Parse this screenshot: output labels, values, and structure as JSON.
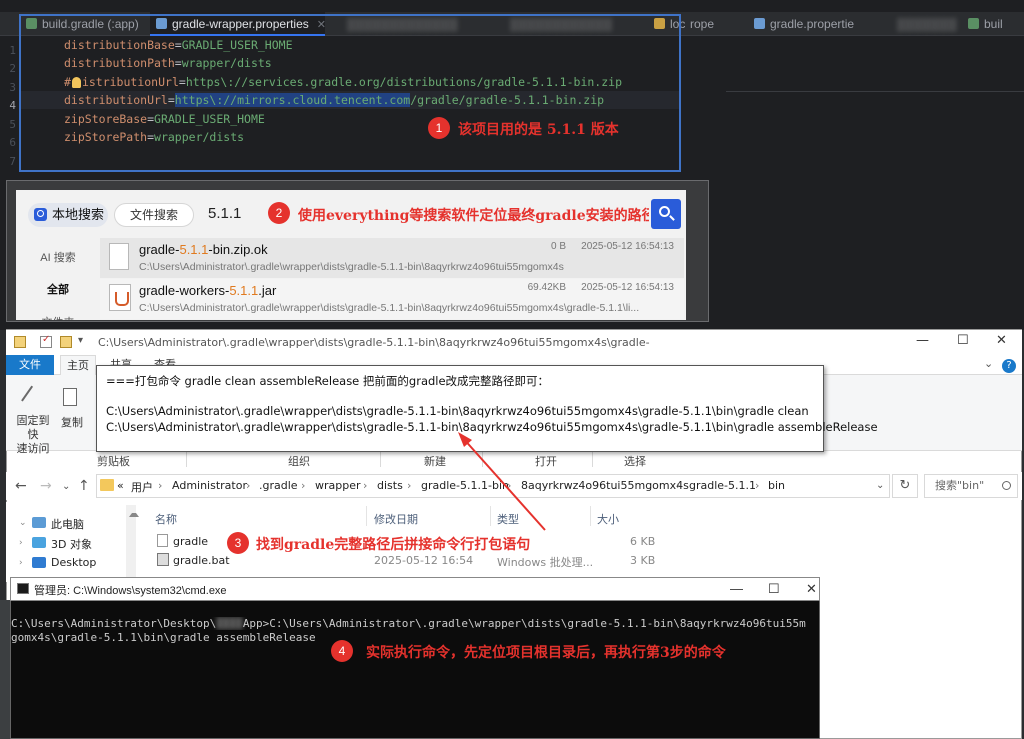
{
  "ide": {
    "tabs": [
      {
        "label": "build.gradle (:app)",
        "icon": "gradle-elephant-icon"
      },
      {
        "label": "gradle-wrapper.properties",
        "icon": "properties-icon"
      },
      {
        "label": "▒▒▒▒▒▒▒▒▒▒▒▒▒",
        "icon": "file-icon"
      },
      {
        "label": "▒▒▒▒▒▒▒▒▒▒▒▒",
        "icon": "file-icon"
      },
      {
        "label": "loc",
        "icon": "file-icon"
      },
      {
        "label": "rope",
        "icon": "file-icon"
      },
      {
        "label": "gradle.propertie",
        "icon": "file-icon"
      },
      {
        "label": "▒▒▒▒▒▒▒",
        "icon": "file-icon"
      },
      {
        "label": "buil",
        "icon": "gradle-elephant-icon"
      }
    ],
    "line_numbers": [
      "1",
      "2",
      "3",
      "4",
      "5",
      "6",
      "7"
    ],
    "code": [
      {
        "key": "distributionBase",
        "eq": "=",
        "value": "GRADLE_USER_HOME"
      },
      {
        "key": "distributionPath",
        "eq": "=",
        "value": "wrapper/dists"
      },
      {
        "key_pre": "#",
        "key_post": "istributionUrl",
        "eq": "=",
        "value": "https\\://services.gradle.org/distributions/gradle-5.1.1-bin.zip"
      },
      {
        "key": "distributionUrl",
        "eq": "=",
        "value_hl": "https\\://mirrors.cloud.tencent.com",
        "value_rest": "/gradle/gradle-5.1.1-bin.zip"
      },
      {
        "key": "zipStoreBase",
        "eq": "=",
        "value": "GRADLE_USER_HOME"
      },
      {
        "key": "zipStorePath",
        "eq": "=",
        "value": "wrapper/dists"
      }
    ]
  },
  "annotations": [
    {
      "num": "1",
      "text": "该项目用的是 5.1.1 版本"
    },
    {
      "num": "2",
      "text": "使用everything等搜索软件定位最终gradle安装的路径"
    },
    {
      "num": "3",
      "text": "找到gradle完整路径后拼接命令行打包语句"
    },
    {
      "num": "4",
      "text": "实际执行命令，先定位项目根目录后，再执行第3步的命令"
    }
  ],
  "search": {
    "tab_local": "本地搜索",
    "tab_file": "文件搜索",
    "query": "5.1.1",
    "sidebar": [
      "AI 搜索",
      "全部",
      "文件夹"
    ],
    "results": [
      {
        "name_pre": "gradle-",
        "name_ver": "5.1.1",
        "name_post": "-bin.zip.ok",
        "size": "0 B",
        "date": "2025-05-12 16:54:13",
        "path": "C:\\Users\\Administrator\\.gradle\\wrapper\\dists\\gradle-5.1.1-bin\\8aqyrkrwz4o96tui55mgomx4s"
      },
      {
        "name_pre": "gradle-workers-",
        "name_ver": "5.1.1",
        "name_post": ".jar",
        "size": "69.42KB",
        "date": "2025-05-12 16:54:13",
        "path": "C:\\Users\\Administrator\\.gradle\\wrapper\\dists\\gradle-5.1.1-bin\\8aqyrkrwz4o96tui55mgomx4s\\gradle-5.1.1\\li..."
      }
    ]
  },
  "explorer": {
    "title": "C:\\Users\\Administrator\\.gradle\\wrapper\\dists\\gradle-5.1.1-bin\\8aqyrkrwz4o96tui55mgomx4s\\gradle-",
    "window_controls": {
      "minimize": "—",
      "maximize": "☐",
      "close": "✕"
    },
    "ribbon_tabs": [
      "文件",
      "主页",
      "共享",
      "查看"
    ],
    "ribbon_buttons": {
      "pin": "固定到快\n速访问",
      "copy": "复制"
    },
    "ribbon_groups": [
      "剪贴板",
      "组织",
      "新建",
      "打开",
      "选择"
    ],
    "overlay": {
      "line1": "===打包命令 gradle clean assembleRelease 把前面的gradle改成完整路径即可：",
      "line2": "C:\\Users\\Administrator\\.gradle\\wrapper\\dists\\gradle-5.1.1-bin\\8aqyrkrwz4o96tui55mgomx4s\\gradle-5.1.1\\bin\\gradle clean",
      "line3": "C:\\Users\\Administrator\\.gradle\\wrapper\\dists\\gradle-5.1.1-bin\\8aqyrkrwz4o96tui55mgomx4s\\gradle-5.1.1\\bin\\gradle assembleRelease"
    },
    "breadcrumb": [
      "«",
      "用户",
      "Administrator",
      ".gradle",
      "wrapper",
      "dists",
      "gradle-5.1.1-bin",
      "8aqyrkrwz4o96tui55mgomx4s",
      "gradle-5.1.1",
      "bin"
    ],
    "search_placeholder": "搜索\"bin\"",
    "nav_items": [
      "此电脑",
      "3D 对象",
      "Desktop"
    ],
    "columns": [
      "名称",
      "修改日期",
      "类型",
      "大小"
    ],
    "files": [
      {
        "name": "gradle",
        "date": "",
        "type": "",
        "size": "6 KB"
      },
      {
        "name": "gradle.bat",
        "date": "2025-05-12 16:54",
        "type": "Windows 批处理...",
        "size": "3 KB"
      }
    ]
  },
  "cmd": {
    "title": "管理员: C:\\Windows\\system32\\cmd.exe",
    "line1_pre": "C:\\Users\\Administrator\\Desktop\\",
    "line1_blur": "▒▒▒▒",
    "line1_post": "App>C:\\Users\\Administrator\\.gradle\\wrapper\\dists\\gradle-5.1.1-bin\\8aqyrkrwz4o96tui55m",
    "line2": "gomx4s\\gradle-5.1.1\\bin\\gradle assembleRelease"
  },
  "colors": {
    "accent_red": "#e5322d",
    "ide_key": "#cf8e6d",
    "ide_value": "#6aab73",
    "explorer_blue": "#1979ca",
    "everything_blue": "#2a5cd9"
  }
}
